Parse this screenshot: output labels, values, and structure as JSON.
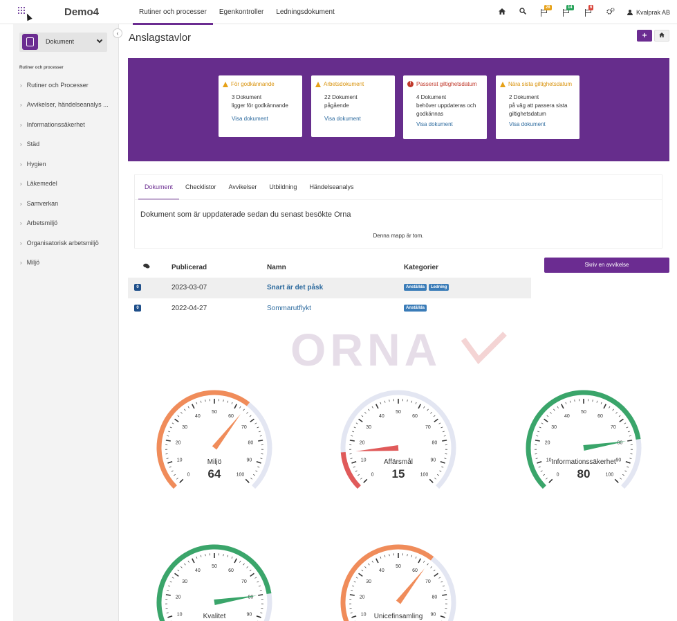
{
  "app": {
    "brand": "Demo4"
  },
  "topnav": {
    "tabs": [
      {
        "label": "Rutiner och processer"
      },
      {
        "label": "Egenkontroller"
      },
      {
        "label": "Ledningsdokument"
      }
    ]
  },
  "topright": {
    "flag_badges": [
      "28",
      "14",
      "6"
    ],
    "user": "Kvalprak AB"
  },
  "sidebar": {
    "selector_label": "Dokument",
    "section_title": "Rutiner och processer",
    "items": [
      {
        "label": "Rutiner och Processer"
      },
      {
        "label": "Avvikelser, händelseanalys ..."
      },
      {
        "label": "Informationssäkerhet"
      },
      {
        "label": "Städ"
      },
      {
        "label": "Hygien"
      },
      {
        "label": "Läkemedel"
      },
      {
        "label": "Samverkan"
      },
      {
        "label": "Arbetsmiljö"
      },
      {
        "label": "Organisatorisk arbetsmiljö"
      },
      {
        "label": "Miljö"
      }
    ]
  },
  "main": {
    "title": "Anslagstavlor",
    "cards": [
      {
        "title": "För godkännande",
        "line1": "3 Dokument",
        "line2": "ligger för godkännande",
        "link": "Visa dokument",
        "color": "#d9930d"
      },
      {
        "title": "Arbetsdokument",
        "line1": "22 Dokument",
        "line2": "pågående",
        "link": "Visa dokument",
        "color": "#d9930d"
      },
      {
        "title": "Passerat giltighetsdatum",
        "line1": "4 Dokument",
        "line2": "behöver uppdateras och godkännas",
        "link": "Visa dokument",
        "color": "#c0392b"
      },
      {
        "title": "Nära sista giltighetsdatum",
        "line1": "2 Dokument",
        "line2": "på väg att passera sista giltighetsdatum",
        "link": "Visa dokument",
        "color": "#d9930d"
      }
    ],
    "tabs": [
      {
        "label": "Dokument"
      },
      {
        "label": "Checklistor"
      },
      {
        "label": "Avvikelser"
      },
      {
        "label": "Utbildning"
      },
      {
        "label": "Händelseanalys"
      }
    ],
    "info_text": "Dokument som är uppdaterade sedan du senast besökte Orna",
    "empty_text": "Denna mapp är tom.",
    "table": {
      "headers": {
        "published": "Publicerad",
        "name": "Namn",
        "categories": "Kategorier"
      },
      "rows": [
        {
          "count": "0",
          "date": "2023-03-07",
          "name": "Snart är det påsk",
          "tags": [
            "Anställda",
            "Ledning"
          ]
        },
        {
          "count": "0",
          "date": "2022-04-27",
          "name": "Sommarutflykt",
          "tags": [
            "Anställda"
          ]
        }
      ]
    },
    "report_button": "Skriv en avvikelse",
    "watermark": "ORNA"
  },
  "gauges": [
    {
      "label": "Miljö",
      "value": 64,
      "color": "#f08c5a"
    },
    {
      "label": "Affärsmål",
      "value": 15,
      "color": "#e05a5a"
    },
    {
      "label": "Informationssäkerhet",
      "value": 80,
      "color": "#3aa56a"
    },
    {
      "label": "Kvalitet",
      "value": 80,
      "color": "#3aa56a"
    },
    {
      "label": "Unicefinsamling",
      "value": 64,
      "color": "#f08c5a"
    }
  ]
}
